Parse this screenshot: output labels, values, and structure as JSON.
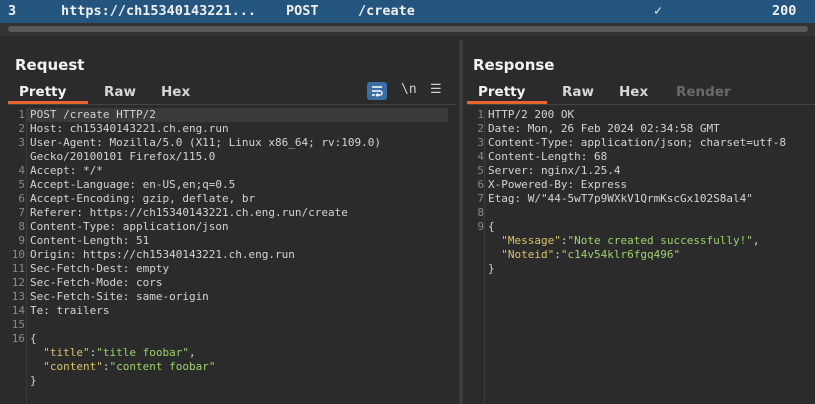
{
  "history": {
    "index": "3",
    "url": "https://ch15340143221...",
    "method": "POST",
    "path": "/create",
    "check": "✓",
    "status": "200"
  },
  "request": {
    "title": "Request",
    "tabs": [
      "Pretty",
      "Raw",
      "Hex"
    ],
    "active_tab": "Pretty",
    "tools": {
      "wrap": "wrap-icon",
      "newline": "\\n",
      "menu": "☰"
    },
    "lines": [
      {
        "n": "1",
        "text": "POST /create HTTP/2"
      },
      {
        "n": "2",
        "text": "Host: ch15340143221.ch.eng.run"
      },
      {
        "n": "3",
        "text": "User-Agent: Mozilla/5.0 (X11; Linux x86_64; rv:109.0)"
      },
      {
        "n": "",
        "text": "Gecko/20100101 Firefox/115.0"
      },
      {
        "n": "4",
        "text": "Accept: */*"
      },
      {
        "n": "5",
        "text": "Accept-Language: en-US,en;q=0.5"
      },
      {
        "n": "6",
        "text": "Accept-Encoding: gzip, deflate, br"
      },
      {
        "n": "7",
        "text": "Referer: https://ch15340143221.ch.eng.run/create"
      },
      {
        "n": "8",
        "text": "Content-Type: application/json"
      },
      {
        "n": "9",
        "text": "Content-Length: 51"
      },
      {
        "n": "10",
        "text": "Origin: https://ch15340143221.ch.eng.run"
      },
      {
        "n": "11",
        "text": "Sec-Fetch-Dest: empty"
      },
      {
        "n": "12",
        "text": "Sec-Fetch-Mode: cors"
      },
      {
        "n": "13",
        "text": "Sec-Fetch-Site: same-origin"
      },
      {
        "n": "14",
        "text": "Te: trailers"
      },
      {
        "n": "15",
        "text": ""
      },
      {
        "n": "16",
        "text": "{"
      }
    ],
    "body": [
      {
        "key": "\"title\"",
        "sep": ":",
        "val": "\"title foobar\"",
        "tail": ","
      },
      {
        "key": "\"content\"",
        "sep": ":",
        "val": "\"content foobar\"",
        "tail": ""
      }
    ],
    "close": "}"
  },
  "response": {
    "title": "Response",
    "tabs": [
      "Pretty",
      "Raw",
      "Hex",
      "Render"
    ],
    "active_tab": "Pretty",
    "lines": [
      {
        "n": "1",
        "text": "HTTP/2 200 OK"
      },
      {
        "n": "2",
        "text": "Date: Mon, 26 Feb 2024 02:34:58 GMT"
      },
      {
        "n": "3",
        "text": "Content-Type: application/json; charset=utf-8"
      },
      {
        "n": "4",
        "text": "Content-Length: 68"
      },
      {
        "n": "5",
        "text": "Server: nginx/1.25.4"
      },
      {
        "n": "6",
        "text": "X-Powered-By: Express"
      },
      {
        "n": "7",
        "text": "Etag: W/\"44-5wT7p9WXkV1QrmKscGx102S8al4\""
      },
      {
        "n": "8",
        "text": ""
      },
      {
        "n": "9",
        "text": "{"
      }
    ],
    "body": [
      {
        "key": "\"Message\"",
        "sep": ":",
        "val": "\"Note created successfully!\"",
        "tail": ","
      },
      {
        "key": "\"Noteid\"",
        "sep": ":",
        "val": "\"c14v54klr6fgq496\"",
        "tail": ""
      }
    ],
    "close": "}"
  },
  "colors": {
    "accent": "#e8652f",
    "selected_row": "#23557e",
    "json_key": "#d9c36a",
    "json_string": "#9fd16c"
  }
}
